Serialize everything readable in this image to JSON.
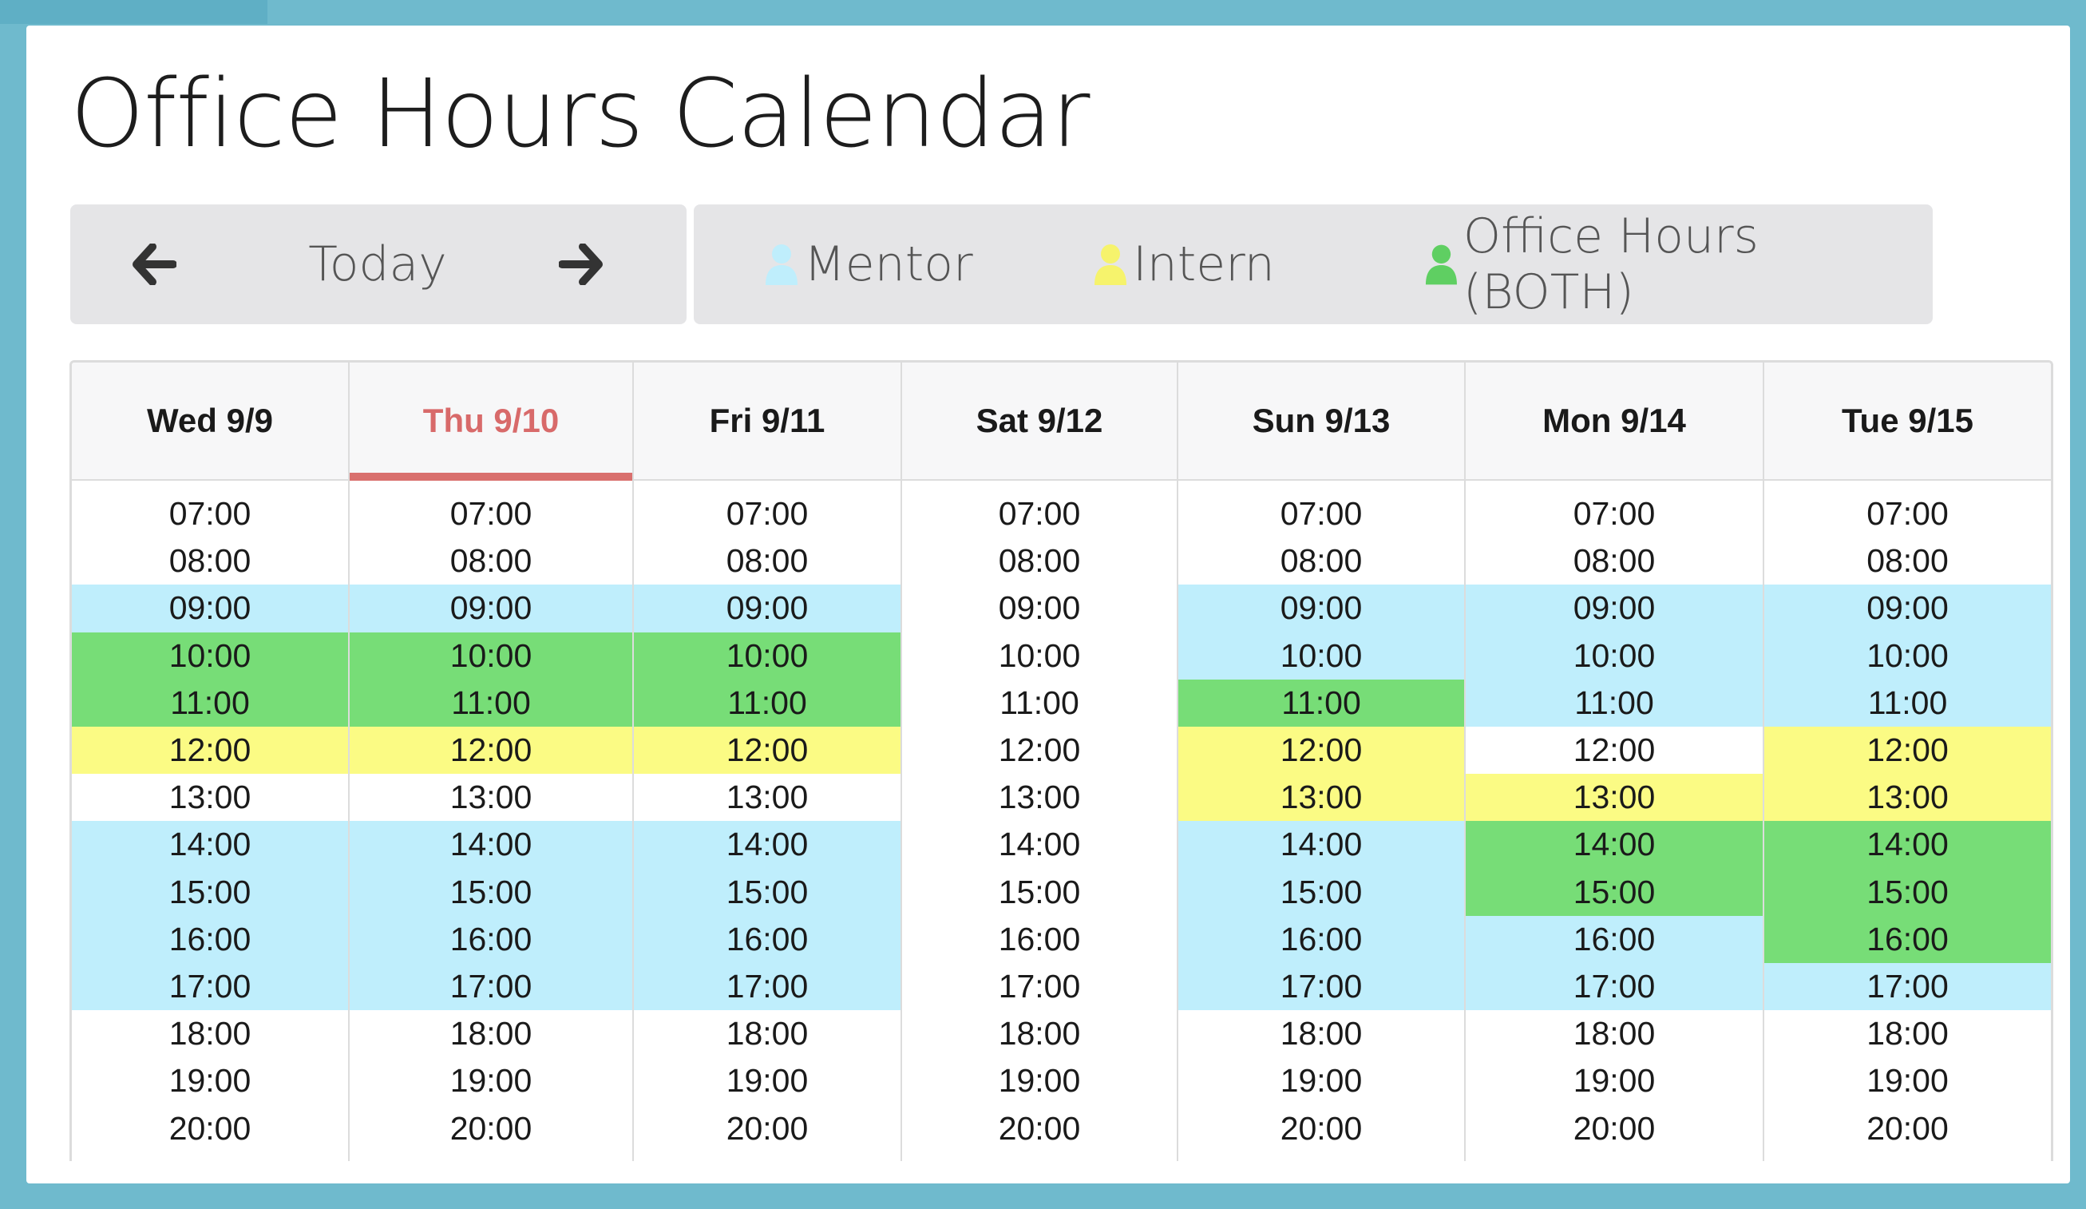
{
  "title": "Office Hours Calendar",
  "nav": {
    "prev_icon": "arrow-left-icon",
    "today_label": "Today",
    "next_icon": "arrow-right-icon"
  },
  "legend": [
    {
      "label": "Mentor",
      "color": "#bfeefc",
      "icon": "user-icon"
    },
    {
      "label": "Intern",
      "color": "#fbfb84",
      "icon": "user-icon"
    },
    {
      "label": "Office Hours (BOTH)",
      "color": "#77dd77",
      "icon": "user-icon"
    }
  ],
  "colors": {
    "mentor": "#bfeefc",
    "intern": "#fbfb84",
    "both": "#77dd77",
    "today_accent": "#d86a6a"
  },
  "times": [
    "07:00",
    "08:00",
    "09:00",
    "10:00",
    "11:00",
    "12:00",
    "13:00",
    "14:00",
    "15:00",
    "16:00",
    "17:00",
    "18:00",
    "19:00",
    "20:00"
  ],
  "days": [
    {
      "label": "Wed 9/9",
      "today": false,
      "slots": [
        "",
        "",
        "mentor",
        "both",
        "both",
        "intern",
        "",
        "mentor",
        "mentor",
        "mentor",
        "mentor",
        "",
        "",
        ""
      ]
    },
    {
      "label": "Thu 9/10",
      "today": true,
      "slots": [
        "",
        "",
        "mentor",
        "both",
        "both",
        "intern",
        "",
        "mentor",
        "mentor",
        "mentor",
        "mentor",
        "",
        "",
        ""
      ]
    },
    {
      "label": "Fri 9/11",
      "today": false,
      "slots": [
        "",
        "",
        "mentor",
        "both",
        "both",
        "intern",
        "",
        "mentor",
        "mentor",
        "mentor",
        "mentor",
        "",
        "",
        ""
      ]
    },
    {
      "label": "Sat 9/12",
      "today": false,
      "slots": [
        "",
        "",
        "",
        "",
        "",
        "",
        "",
        "",
        "",
        "",
        "",
        "",
        "",
        ""
      ]
    },
    {
      "label": "Sun 9/13",
      "today": false,
      "slots": [
        "",
        "",
        "mentor",
        "mentor",
        "both",
        "intern",
        "intern",
        "mentor",
        "mentor",
        "mentor",
        "mentor",
        "",
        "",
        ""
      ]
    },
    {
      "label": "Mon 9/14",
      "today": false,
      "slots": [
        "",
        "",
        "mentor",
        "mentor",
        "mentor",
        "",
        "intern",
        "both",
        "both",
        "mentor",
        "mentor",
        "",
        "",
        ""
      ]
    },
    {
      "label": "Tue 9/15",
      "today": false,
      "slots": [
        "",
        "",
        "mentor",
        "mentor",
        "mentor",
        "intern",
        "intern",
        "both",
        "both",
        "both",
        "mentor",
        "",
        "",
        ""
      ]
    }
  ]
}
